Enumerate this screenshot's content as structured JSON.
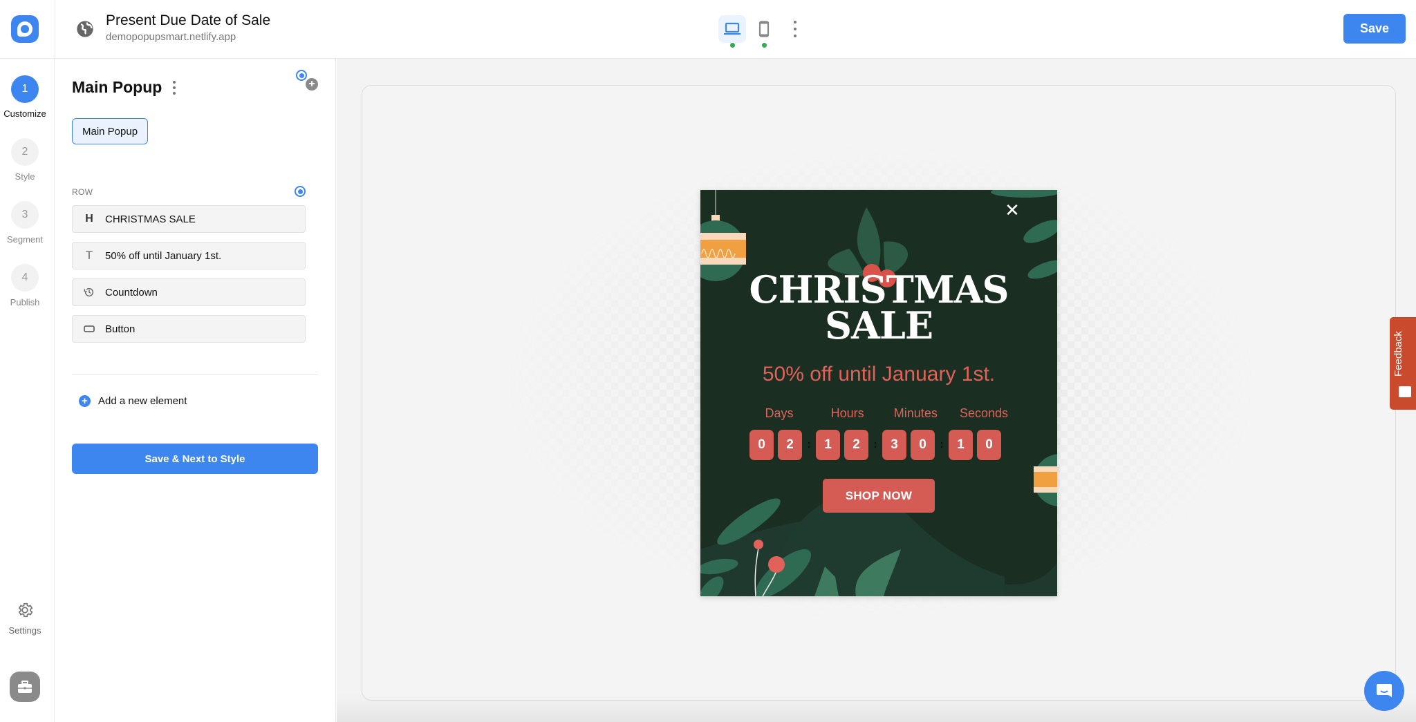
{
  "header": {
    "campaign_title": "Present Due Date of Sale",
    "site_url": "demopopupsmart.netlify.app",
    "devices": [
      {
        "name": "desktop",
        "active": true,
        "status": "live"
      },
      {
        "name": "mobile",
        "active": false,
        "status": "live"
      }
    ],
    "save_label": "Save"
  },
  "steps": [
    {
      "number": "1",
      "label": "Customize",
      "active": true
    },
    {
      "number": "2",
      "label": "Style",
      "active": false
    },
    {
      "number": "3",
      "label": "Segment",
      "active": false
    },
    {
      "number": "4",
      "label": "Publish",
      "active": false
    }
  ],
  "settings_label": "Settings",
  "panel": {
    "title": "Main Popup",
    "popup_chip": "Main Popup",
    "row_label": "ROW",
    "elements": [
      {
        "icon": "heading-icon",
        "label": "CHRISTMAS SALE"
      },
      {
        "icon": "text-icon",
        "label": "50% off until January 1st."
      },
      {
        "icon": "countdown-icon",
        "label": "Countdown"
      },
      {
        "icon": "button-icon",
        "label": "Button"
      }
    ],
    "add_element_label": "Add a new element",
    "next_button_label": "Save & Next to Style"
  },
  "popup": {
    "heading_line1": "CHRISTMAS",
    "heading_line2": "SALE",
    "subtitle": "50% off until January 1st.",
    "countdown": {
      "labels": [
        "Days",
        "Hours",
        "Minutes",
        "Seconds"
      ],
      "days": [
        "0",
        "2"
      ],
      "hours": [
        "1",
        "2"
      ],
      "minutes": [
        "3",
        "0"
      ],
      "seconds": [
        "1",
        "0"
      ],
      "separator": ":"
    },
    "cta_label": "SHOP NOW",
    "colors": {
      "background": "#1b2e22",
      "accent": "#d45c54",
      "leaf": "#2f6a52"
    }
  },
  "feedback_label": "Feedback",
  "colors": {
    "primary": "#3d86f0",
    "feedback": "#c94a2c"
  }
}
